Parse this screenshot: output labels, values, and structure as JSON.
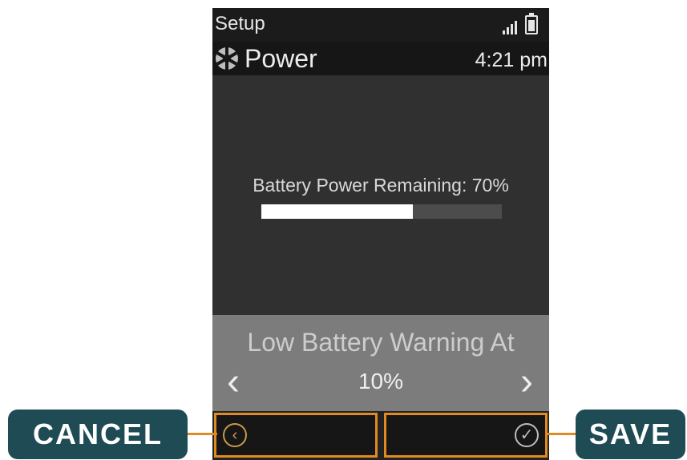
{
  "status_bar": {
    "app_title": "Setup",
    "signal_icon": "signal-icon",
    "battery_icon": "battery-icon"
  },
  "header": {
    "icon": "power-settings-icon",
    "title": "Power",
    "time": "4:21 pm"
  },
  "battery": {
    "label": "Battery Power Remaining: 70%",
    "remaining_percent": 70
  },
  "low_battery_warning": {
    "label": "Low Battery Warning At",
    "value": "10%",
    "prev_icon": "chevron-left-icon",
    "next_icon": "chevron-right-icon"
  },
  "softkeys": {
    "left_icon": "back-icon",
    "right_icon": "check-icon"
  },
  "callouts": {
    "cancel": "CANCEL",
    "save": "SAVE"
  },
  "colors": {
    "highlight": "#e08a22",
    "callout_bg": "#1f4b55",
    "screen_bg": "#303030"
  }
}
